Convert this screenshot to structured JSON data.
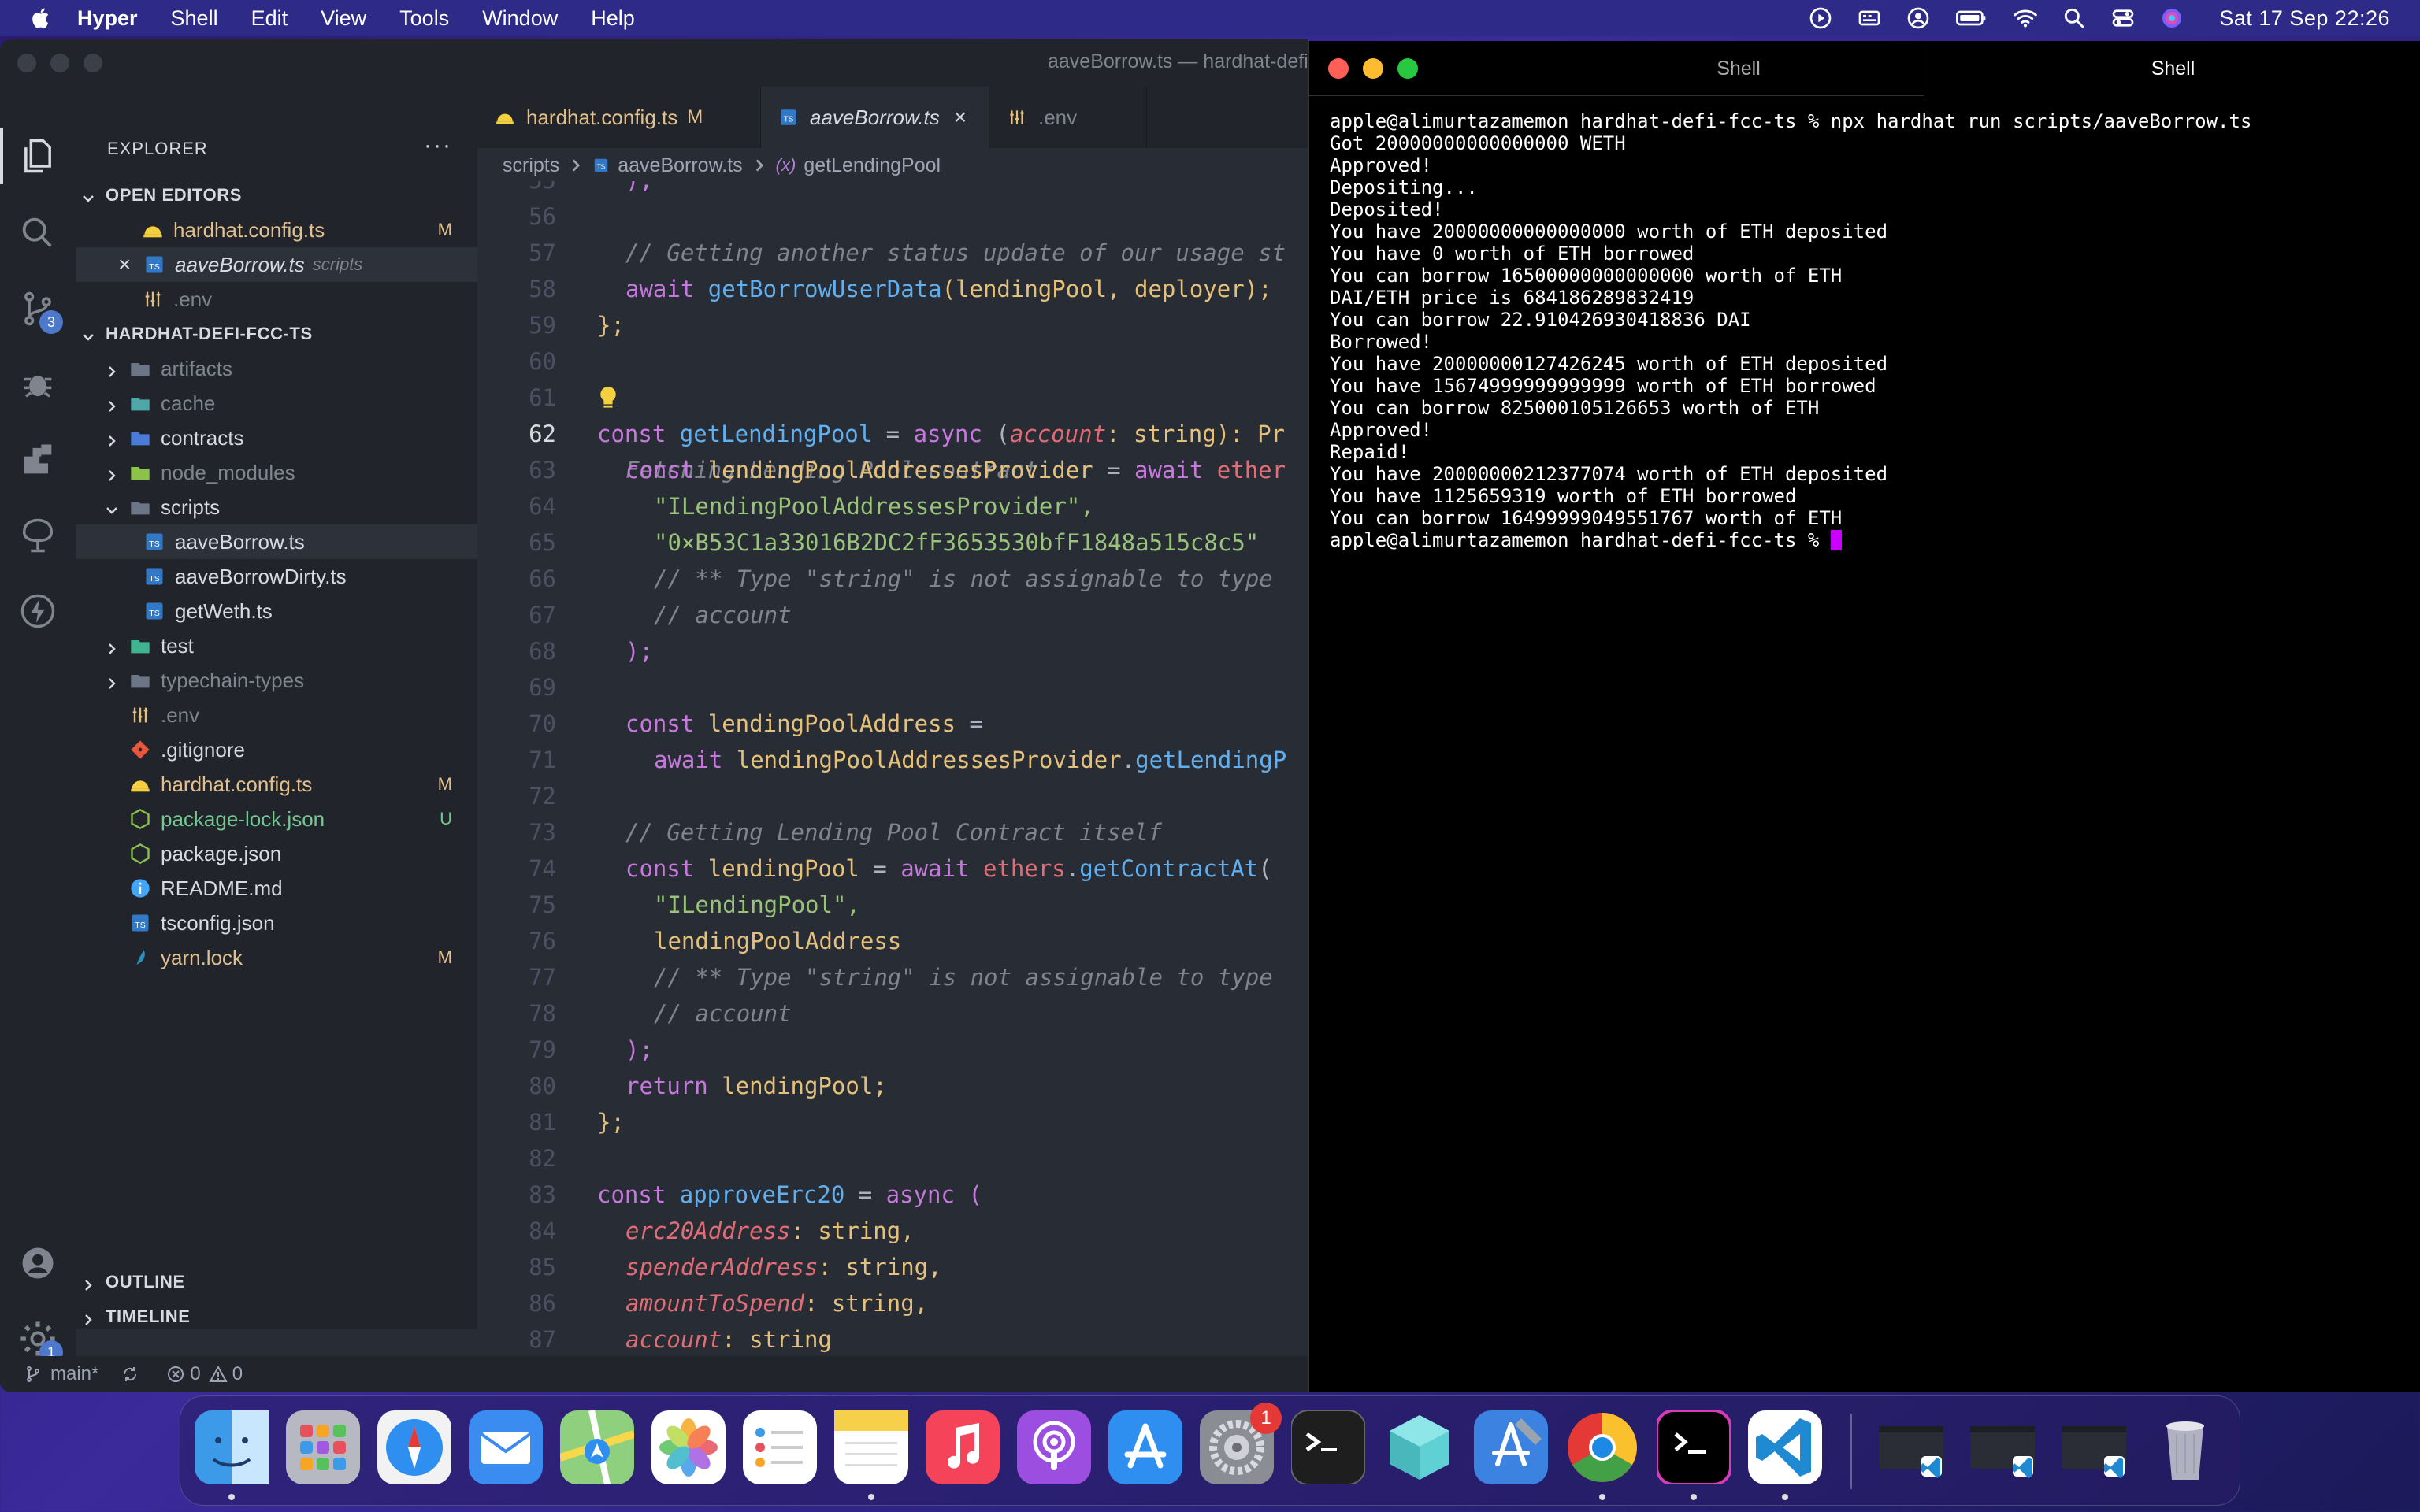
{
  "menubar": {
    "app": "Hyper",
    "items": [
      "Shell",
      "Edit",
      "View",
      "Tools",
      "Window",
      "Help"
    ],
    "clock": "Sat 17 Sep  22:26"
  },
  "vscode": {
    "window_title": "aaveBorrow.ts — hardhat-defi-fcc-ts",
    "explorer": {
      "title": "EXPLORER",
      "open_editors_title": "OPEN EDITORS",
      "open_editors": [
        {
          "name": "hardhat.config.ts",
          "status": "M"
        },
        {
          "name": "aaveBorrow.ts",
          "desc": "scripts"
        },
        {
          "name": ".env"
        }
      ],
      "project_title": "HARDHAT-DEFI-FCC-TS",
      "tree": [
        {
          "name": "artifacts"
        },
        {
          "name": "cache"
        },
        {
          "name": "contracts"
        },
        {
          "name": "node_modules"
        },
        {
          "name": "scripts"
        },
        {
          "name": "aaveBorrow.ts"
        },
        {
          "name": "aaveBorrowDirty.ts"
        },
        {
          "name": "getWeth.ts"
        },
        {
          "name": "test"
        },
        {
          "name": "typechain-types"
        },
        {
          "name": ".env"
        },
        {
          "name": ".gitignore"
        },
        {
          "name": "hardhat.config.ts",
          "status": "M"
        },
        {
          "name": "package-lock.json",
          "status": "U"
        },
        {
          "name": "package.json"
        },
        {
          "name": "README.md"
        },
        {
          "name": "tsconfig.json"
        },
        {
          "name": "yarn.lock",
          "status": "M"
        }
      ],
      "outline_title": "OUTLINE",
      "timeline_title": "TIMELINE"
    },
    "tabs": [
      {
        "label": "hardhat.config.ts",
        "status": "M"
      },
      {
        "label": "aaveBorrow.ts"
      },
      {
        "label": ".env"
      }
    ],
    "breadcrumb": {
      "folder": "scripts",
      "file": "aaveBorrow.ts",
      "symbol": "getLendingPool"
    },
    "line_numbers": [
      "55",
      "56",
      "57",
      "58",
      "59",
      "60",
      "61",
      "62",
      "63",
      "64",
      "65",
      "66",
      "67",
      "68",
      "69",
      "70",
      "71",
      "72",
      "73",
      "74",
      "75",
      "76",
      "77",
      "78",
      "79",
      "80",
      "81",
      "82",
      "83",
      "84",
      "85",
      "86",
      "87"
    ],
    "code": {
      "l55": ");",
      "l57": "// Getting another status update of our usage st",
      "l58a": "await ",
      "l58b": "getBorrowUserData",
      "l58c": "(lendingPool, deployer);",
      "l59": "};",
      "l61": "Fetching Lending Pool contract",
      "l62a": "const ",
      "l62b": "getLendingPool",
      "l62c": " = ",
      "l62d": "async",
      "l62e": " (",
      "l62f": "account",
      "l62g": ": string): Pr",
      "l63a": "const ",
      "l63b": "lendingPoolAddressesProvider",
      "l63c": " = ",
      "l63d": "await ",
      "l63e": "ether",
      "l64": "\"ILendingPoolAddressesProvider\",",
      "l65": "\"0×B53C1a33016B2DC2fF3653530bfF1848a515c8c5\"",
      "l66": "// ** Type \"string\" is not assignable to type",
      "l67": "// account",
      "l68": ");",
      "l70a": "const ",
      "l70b": "lendingPoolAddress",
      "l70c": " =",
      "l71a": "await ",
      "l71b": "lendingPoolAddressesProvider",
      "l71c": ".",
      "l71d": "getLendingP",
      "l73": "// Getting Lending Pool Contract itself",
      "l74a": "const ",
      "l74b": "lendingPool",
      "l74c": " = ",
      "l74d": "await ",
      "l74e": "ethers",
      "l74f": ".",
      "l74g": "getContractAt",
      "l74h": "(",
      "l75": "\"ILendingPool\",",
      "l76": "lendingPoolAddress",
      "l77": "// ** Type \"string\" is not assignable to type",
      "l78": "// account",
      "l79": ");",
      "l80a": "return ",
      "l80b": "lendingPool;",
      "l81": "};",
      "l83a": "const ",
      "l83b": "approveErc20",
      "l83c": " = ",
      "l83d": "async",
      "l83e": " (",
      "l84a": "erc20Address",
      "l84b": ": string,",
      "l85a": "spenderAddress",
      "l85b": ": string,",
      "l86a": "amountToSpend",
      "l86b": ": string,",
      "l87a": "account",
      "l87b": ": string"
    },
    "status": {
      "branch": "main*",
      "errors": "0",
      "warnings": "0"
    },
    "badges": {
      "scm": "3",
      "settings": "1"
    }
  },
  "hyper": {
    "tabs": [
      "Shell",
      "Shell"
    ],
    "lines": [
      "apple@alimurtazamemon hardhat-defi-fcc-ts % npx hardhat run scripts/aaveBorrow.ts",
      "Got 20000000000000000 WETH",
      "Approved!",
      "Depositing...",
      "Deposited!",
      "You have 20000000000000000 worth of ETH deposited",
      "You have 0 worth of ETH borrowed",
      "You can borrow 16500000000000000 worth of ETH",
      "DAI/ETH price is 684186289832419",
      "You can borrow 22.910426930418836 DAI",
      "Borrowed!",
      "You have 20000000127426245 worth of ETH deposited",
      "You have 15674999999999999 worth of ETH borrowed",
      "You can borrow 825000105126653 worth of ETH",
      "Approved!",
      "Repaid!",
      "You have 20000000212377074 worth of ETH deposited",
      "You have 1125659319 worth of ETH borrowed",
      "You can borrow 16499999049551767 worth of ETH"
    ],
    "prompt": "apple@alimurtazamemon hardhat-defi-fcc-ts % "
  },
  "dock": {
    "settings_badge": "1",
    "apps": [
      "finder-icon",
      "launchpad-icon",
      "safari-icon",
      "mail-icon",
      "maps-icon",
      "photos-icon",
      "reminders-icon",
      "notes-icon",
      "music-icon",
      "podcasts-icon",
      "app-store-icon",
      "system-preferences-icon",
      "terminal-icon",
      "cube-icon",
      "xcode-icon",
      "chrome-icon",
      "hyper-icon",
      "vscode-icon"
    ]
  }
}
